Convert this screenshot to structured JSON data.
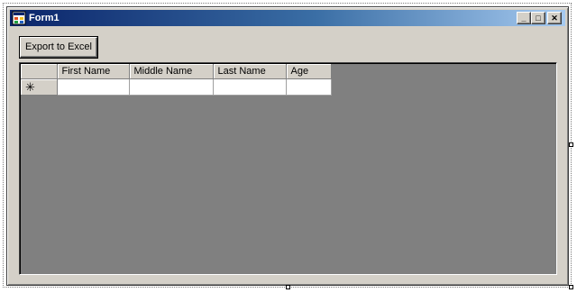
{
  "window": {
    "title": "Form1",
    "minimize_glyph": "_",
    "maximize_glyph": "□",
    "close_glyph": "✕"
  },
  "toolbar": {
    "export_label": "Export to Excel"
  },
  "grid": {
    "columns": [
      "First Name",
      "Middle Name",
      "Last Name",
      "Age"
    ],
    "new_row_glyph": "✳",
    "background_color": "#808080"
  }
}
